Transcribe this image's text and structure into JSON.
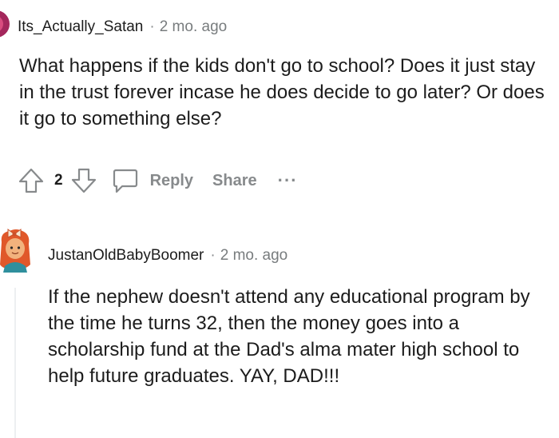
{
  "comments": [
    {
      "username": "Its_Actually_Satan",
      "separator": "·",
      "time": "2 mo. ago",
      "body": "What happens if the kids don't go to school? Does it just stay in the trust forever incase he does decide to go later? Or does it go to something else?",
      "votes": "2",
      "reply_label": "Reply",
      "share_label": "Share",
      "more_label": "···"
    },
    {
      "username": "JustanOldBabyBoomer",
      "separator": "·",
      "time": "2 mo. ago",
      "body": "If the nephew doesn't attend any educational program by the time he turns 32, then the money goes into a scholarship fund at the Dad's alma mater high school to help future graduates. YAY, DAD!!!"
    }
  ],
  "icons": {
    "upvote": "upvote-arrow-icon",
    "downvote": "downvote-arrow-icon",
    "reply": "speech-bubble-icon",
    "more": "ellipsis-icon"
  },
  "colors": {
    "text": "#1c1c1c",
    "muted": "#878a8c",
    "avatar1": "#a4275c",
    "avatar2_skin": "#f2b27d",
    "avatar2_hair": "#e0582a"
  }
}
